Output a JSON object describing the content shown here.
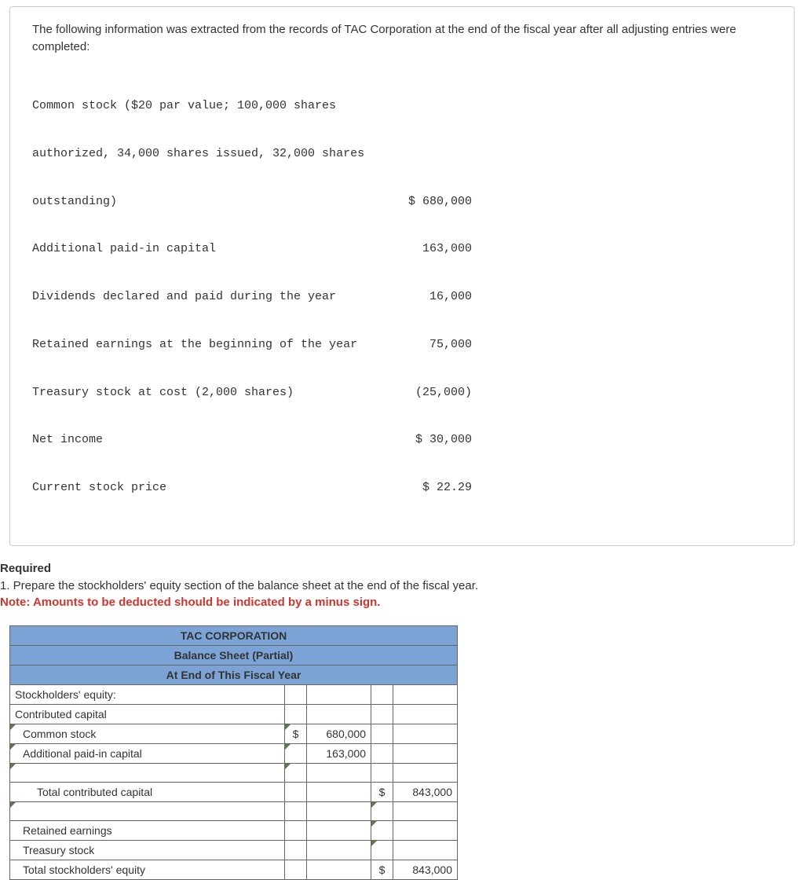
{
  "intro": "The following information was extracted from the records of TAC Corporation at the end of the fiscal year after all adjusting entries were completed:",
  "records": {
    "common_stock_desc_l1": "Common stock ($20 par value; 100,000 shares",
    "common_stock_desc_l2": "authorized, 34,000 shares issued, 32,000 shares",
    "common_stock_desc_l3": "outstanding)",
    "common_stock_val": "$ 680,000",
    "apic_label": "Additional paid-in capital",
    "apic_val": "163,000",
    "div_label": "Dividends declared and paid during the year",
    "div_val": "16,000",
    "re_label": "Retained earnings at the beginning of the year",
    "re_val": "75,000",
    "treasury_label": "Treasury stock at cost (2,000 shares)",
    "treasury_val": "(25,000)",
    "ni_label": "Net income",
    "ni_val": "$ 30,000",
    "price_label": "Current stock price",
    "price_val": "$ 22.29"
  },
  "required": {
    "heading": "Required",
    "line1": "1. Prepare the stockholders' equity section of the balance sheet at the end of the fiscal year.",
    "note": "Note: Amounts to be deducted should be indicated by a minus sign."
  },
  "sheet": {
    "h1": "TAC CORPORATION",
    "h2": "Balance Sheet (Partial)",
    "h3": "At End of This Fiscal Year",
    "rows": {
      "se": "Stockholders' equity:",
      "cc": "Contributed capital",
      "cs_label": "Common stock",
      "cs_sym": "$",
      "cs_val": "680,000",
      "apic_label": "Additional paid-in capital",
      "apic_val": "163,000",
      "tcc_label": "Total contributed capital",
      "tcc_sym": "$",
      "tcc_val": "843,000",
      "re_label": "Retained earnings",
      "ts_label": "Treasury stock",
      "tse_label": "Total stockholders' equity",
      "tse_sym": "$",
      "tse_val": "843,000"
    }
  }
}
